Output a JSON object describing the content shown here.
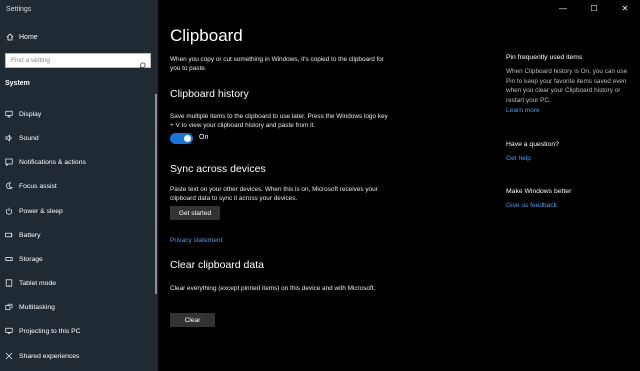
{
  "app": {
    "title": "Settings"
  },
  "sidebar": {
    "home_label": "Home",
    "search_placeholder": "Find a setting",
    "section_label": "System",
    "items": [
      {
        "label": "Display",
        "icon": "display-icon"
      },
      {
        "label": "Sound",
        "icon": "sound-icon"
      },
      {
        "label": "Notifications & actions",
        "icon": "notifications-icon"
      },
      {
        "label": "Focus assist",
        "icon": "focus-assist-icon"
      },
      {
        "label": "Power & sleep",
        "icon": "power-icon"
      },
      {
        "label": "Battery",
        "icon": "battery-icon"
      },
      {
        "label": "Storage",
        "icon": "storage-icon"
      },
      {
        "label": "Tablet mode",
        "icon": "tablet-icon"
      },
      {
        "label": "Multitasking",
        "icon": "multitasking-icon"
      },
      {
        "label": "Projecting to this PC",
        "icon": "projecting-icon"
      },
      {
        "label": "Shared experiences",
        "icon": "shared-experiences-icon"
      }
    ]
  },
  "window_controls": {
    "minimize": "—",
    "maximize": "☐",
    "close": "✕"
  },
  "main": {
    "title": "Clipboard",
    "intro": "When you copy or cut something in Windows, it's copied to the clipboard for you to paste.",
    "history": {
      "heading": "Clipboard history",
      "desc": "Save multiple items to the clipboard to use later. Press the Windows logo key + V to view your clipboard history and paste from it.",
      "toggle_state": "On",
      "toggle_on": true
    },
    "sync": {
      "heading": "Sync across devices",
      "desc": "Paste text on your other devices. When this is on, Microsoft receives your clipboard data to sync it across your devices.",
      "button": "Get started",
      "privacy_link": "Privacy statement"
    },
    "clear": {
      "heading": "Clear clipboard data",
      "desc": "Clear everything (except pinned items) on this device and with Microsoft.",
      "button": "Clear"
    }
  },
  "right_panel": {
    "pin": {
      "heading": "Pin frequently used items",
      "text": "When Clipboard history is On, you can use Pin to keep your favorite items saved even when you clear your Clipboard history or restart your PC.",
      "link": "Learn more"
    },
    "question": {
      "heading": "Have a question?",
      "link": "Get help"
    },
    "feedback": {
      "heading": "Make Windows better",
      "link": "Give us feedback"
    }
  },
  "colors": {
    "accent": "#1a73d8",
    "link": "#4a9fe8",
    "sidebar_bg": "#1f2a33",
    "main_bg": "#000000"
  }
}
